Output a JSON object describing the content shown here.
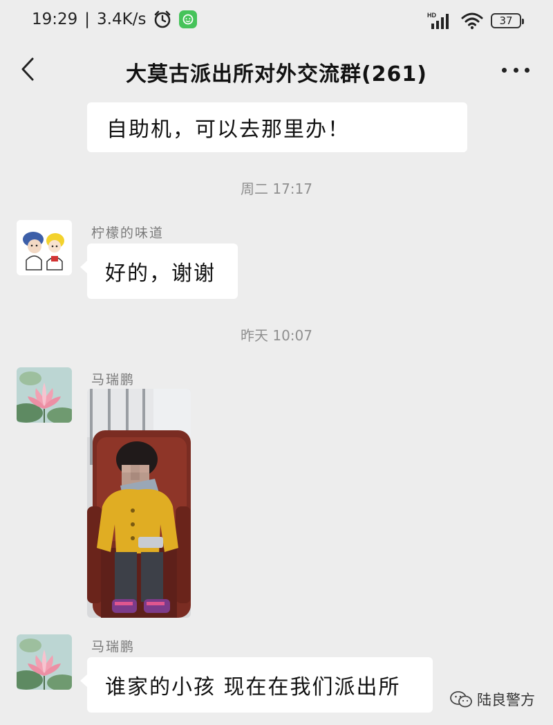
{
  "status_bar": {
    "time": "19:29",
    "separator": "|",
    "net_speed": "3.4K/s",
    "hd_label": "HD",
    "battery": "37",
    "icons": [
      "alarm-icon",
      "app-badge-icon",
      "signal-icon",
      "wifi-icon",
      "battery-icon"
    ]
  },
  "nav": {
    "title": "大莫古派出所对外交流群(261)",
    "back_icon": "chevron-left-icon",
    "more_icon": "more-dots-icon"
  },
  "messages": [
    {
      "type": "text",
      "sender": "",
      "text": "自助机，可以去那里办！"
    },
    {
      "type": "time",
      "text": "周二 17:17"
    },
    {
      "type": "text",
      "sender": "柠檬的味道",
      "avatar": "cartoon-couple-avatar",
      "text": "好的，谢谢"
    },
    {
      "type": "time",
      "text": "昨天 10:07"
    },
    {
      "type": "image",
      "sender": "马瑞鹏",
      "avatar": "lotus-flower-avatar",
      "image": "child-on-red-armchair-photo"
    },
    {
      "type": "text",
      "sender": "马瑞鹏",
      "avatar": "lotus-flower-avatar",
      "text": "谁家的小孩 现在在我们派出所"
    }
  ],
  "watermark": {
    "text": "陆良警方",
    "icon": "wechat-icon"
  },
  "colors": {
    "background": "#ededed",
    "bubble": "#ffffff",
    "meta_text": "#8f8f8f",
    "badge_green": "#46c35a"
  }
}
